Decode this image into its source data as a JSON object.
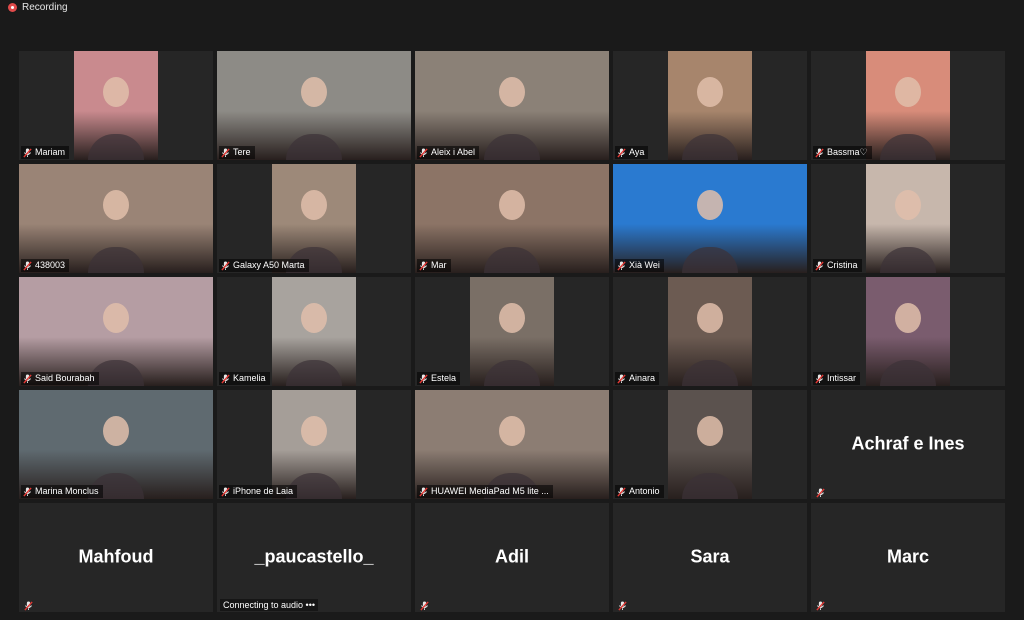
{
  "recording": {
    "label": "Recording"
  },
  "tiles": [
    {
      "name": "Mariam",
      "video": true,
      "bg": "#c98a8e"
    },
    {
      "name": "Tere",
      "video": true,
      "bg": "#8d8b86",
      "wide": true
    },
    {
      "name": "Aleix i Abel",
      "video": true,
      "bg": "#8b8177",
      "wide": true
    },
    {
      "name": "Aya",
      "video": true,
      "bg": "#a7856c"
    },
    {
      "name": "Bassma♡",
      "video": true,
      "bg": "#d88c7a"
    },
    {
      "name": "438003",
      "video": true,
      "bg": "#9a8476",
      "wide": true
    },
    {
      "name": "Galaxy A50 Marta",
      "video": true,
      "bg": "#9d8979"
    },
    {
      "name": "Mar",
      "video": true,
      "bg": "#8c7466",
      "wide": true
    },
    {
      "name": "Xià Wei",
      "video": true,
      "bg": "#2a7ad0",
      "wide": true
    },
    {
      "name": "Cristina",
      "video": true,
      "bg": "#c7b7ac"
    },
    {
      "name": "Said Bourabah",
      "video": true,
      "bg": "#b59da3",
      "wide": true
    },
    {
      "name": "Kamelia",
      "video": true,
      "bg": "#a8a39e"
    },
    {
      "name": "Estela",
      "video": true,
      "bg": "#7a6f66"
    },
    {
      "name": "Ainara",
      "video": true,
      "bg": "#6c5b52"
    },
    {
      "name": "Intissar",
      "video": true,
      "bg": "#7a5c6e"
    },
    {
      "name": "Marina Monclus",
      "video": true,
      "bg": "#5f6a70",
      "wide": true
    },
    {
      "name": "iPhone de Laia",
      "video": true,
      "bg": "#a59e98"
    },
    {
      "name": "HUAWEI MediaPad M5 lite ...",
      "video": true,
      "bg": "#8c7d73",
      "wide": true
    },
    {
      "name": "Antonio",
      "video": true,
      "bg": "#5b524e"
    },
    {
      "name": "Achraf e Ines",
      "video": false
    },
    {
      "name": "Mahfoud",
      "video": false
    },
    {
      "name": "_paucastello_",
      "video": false,
      "status": "Connecting to audio •••"
    },
    {
      "name": "Adil",
      "video": false
    },
    {
      "name": "Sara",
      "video": false
    },
    {
      "name": "Marc",
      "video": false
    }
  ]
}
